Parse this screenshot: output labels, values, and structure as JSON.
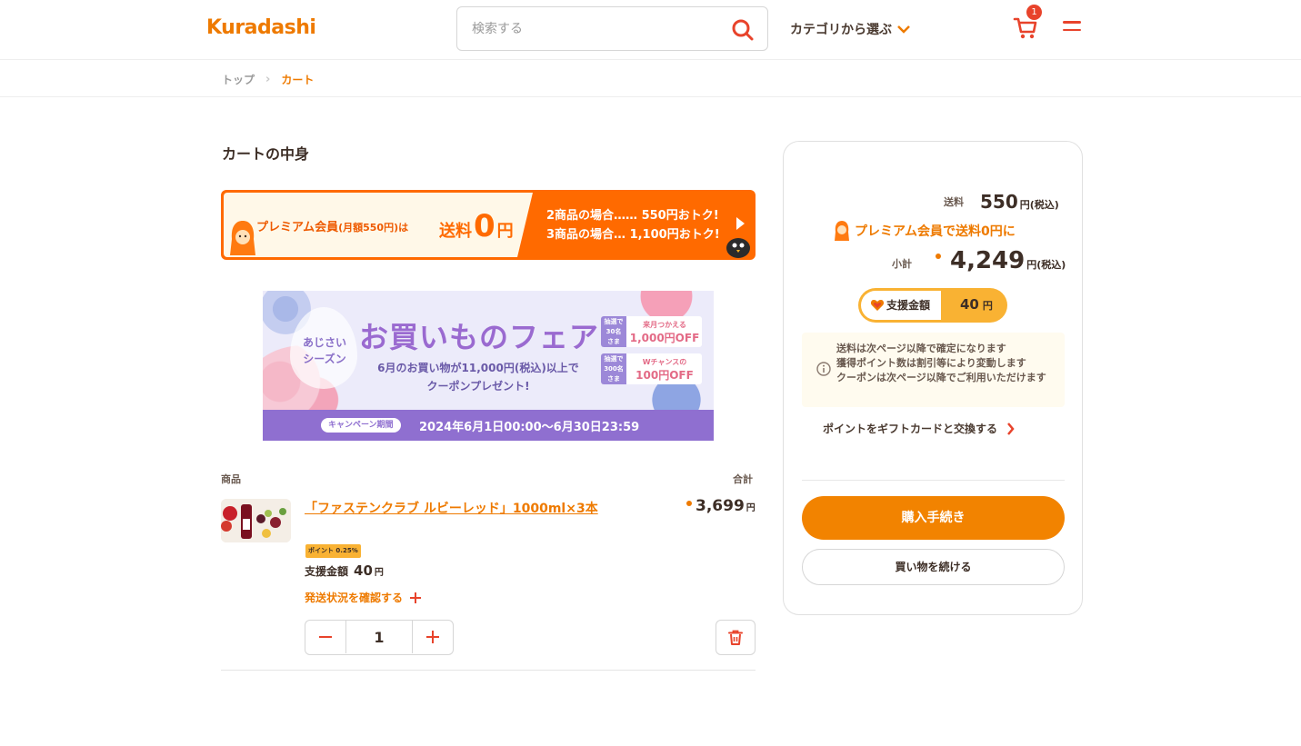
{
  "header": {
    "logo_text": "Kuradashi",
    "search_placeholder": "検索する",
    "category_label": "カテゴリから選ぶ",
    "cart_count": "1"
  },
  "breadcrumb": {
    "items": [
      "トップ",
      "カート"
    ]
  },
  "page_title": "カートの中身",
  "premium_banner": {
    "text": "プレミアム会員",
    "price_note": "(月額550円)は",
    "free_label_pre": "送料",
    "free_label_num": "0",
    "free_label_post": "円",
    "line1": "2商品の場合……  550円おトク!",
    "line2": "3商品の場合… 1,100円おトク!"
  },
  "fair_banner": {
    "drop_text": "あじさい\nシーズン",
    "title": "お買いものフェア",
    "sub1": "6月のお買い物が11,000円(税込)以上で",
    "sub2": "クーポンプレゼント!",
    "coupon1_tag": "抽選で\n30名\nさま",
    "coupon1_top": "来月つかえる",
    "coupon1_main": "1,000円OFF",
    "coupon2_tag": "抽選で\n300名\nさま",
    "coupon2_top": "Wチャンスの",
    "coupon2_main": "100円OFF",
    "period_label": "キャンペーン期間",
    "period_dates": "2024年6月1日00:00〜6月30日23:59"
  },
  "table": {
    "col_item": "商品",
    "col_total": "合計"
  },
  "item": {
    "name": "「ファステンクラブ ルビーレッド」1000ml×3本",
    "price": "3,699",
    "yen": "円",
    "point_badge": "ポイント 0.25%",
    "support_label": "支援金額",
    "support_value": "40",
    "support_yen": "円",
    "ship_link": "発送状況を確認する",
    "quantity": "1"
  },
  "summary": {
    "shipping_label": "送料",
    "shipping_value": "550",
    "tax_note": "円(税込)",
    "premium_link": "プレミアム会員で送料0円に",
    "subtotal_label": "小計",
    "subtotal_value": "4,249",
    "support_label": "支援金額",
    "support_value": "40",
    "support_yen": "円",
    "notice_lines": [
      "送料は次ページ以降で確定になります",
      "獲得ポイント数は割引等により変動します",
      "クーポンは次ページ以降でご利用いただけます"
    ],
    "gift_link": "ポイントをギフトカードと交換する",
    "buy_button": "購入手続き",
    "continue_button": "買い物を続ける"
  },
  "colors": {
    "brand_orange": "#ee7a00",
    "accent_red": "#e8432b",
    "buy_button": "#f28300",
    "support_pill": "#f9b233"
  }
}
